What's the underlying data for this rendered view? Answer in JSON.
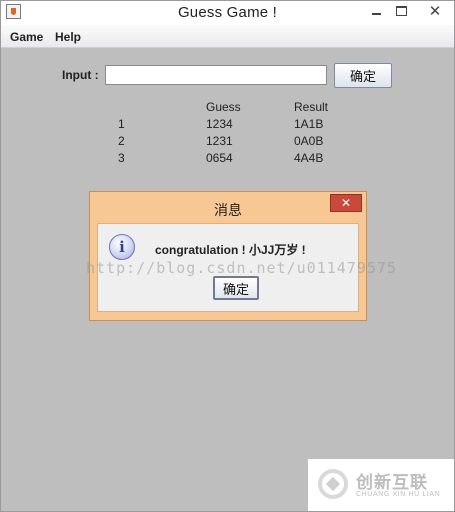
{
  "window": {
    "title": "Guess Game !",
    "icon": "java-cup-icon",
    "controls": {
      "minimize": "minimize-icon",
      "maximize": "maximize-icon",
      "close_glyph": "✕"
    }
  },
  "menubar": {
    "items": [
      {
        "label": "Game"
      },
      {
        "label": "Help"
      }
    ]
  },
  "form": {
    "input_label": "Input :",
    "input_value": "",
    "input_placeholder": "",
    "confirm_label": "确定"
  },
  "results": {
    "headers": {
      "index": "",
      "guess": "Guess",
      "result": "Result"
    },
    "rows": [
      {
        "index": "1",
        "guess": "1234",
        "result": "1A1B"
      },
      {
        "index": "2",
        "guess": "1231",
        "result": "0A0B"
      },
      {
        "index": "3",
        "guess": "0654",
        "result": "4A4B"
      }
    ]
  },
  "dialog": {
    "title": "消息",
    "close_glyph": "✕",
    "icon": "info-icon",
    "icon_glyph": "i",
    "message": "congratulation ! 小JJ万岁 !",
    "ok_label": "确定"
  },
  "watermark": {
    "text": "http://blog.csdn.net/u011479575"
  },
  "branding": {
    "name_cn": "创新互联",
    "name_en": "CHUANG XIN HU LIAN"
  },
  "colors": {
    "window_bg": "#bebebe",
    "dialog_frame": "#f7c894",
    "dialog_close": "#c94a3b"
  }
}
